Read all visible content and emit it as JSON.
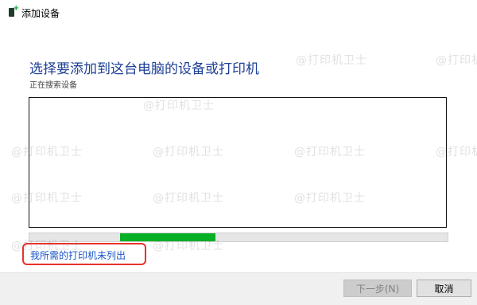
{
  "window": {
    "title": "添加设备",
    "icon": "printer-add-icon"
  },
  "main": {
    "heading": "选择要添加到这台电脑的设备或打印机",
    "status_text": "正在搜索设备",
    "progress_fraction": 0.23,
    "link_text": "我所需的打印机未列出"
  },
  "footer": {
    "next_label": "下一步(N)",
    "cancel_label": "取消"
  },
  "watermark": {
    "text": "@打印机卫士"
  },
  "colors": {
    "heading": "#1c3f96",
    "link": "#1a55c8",
    "progress": "#06b025",
    "highlight_box": "#e8322b"
  }
}
